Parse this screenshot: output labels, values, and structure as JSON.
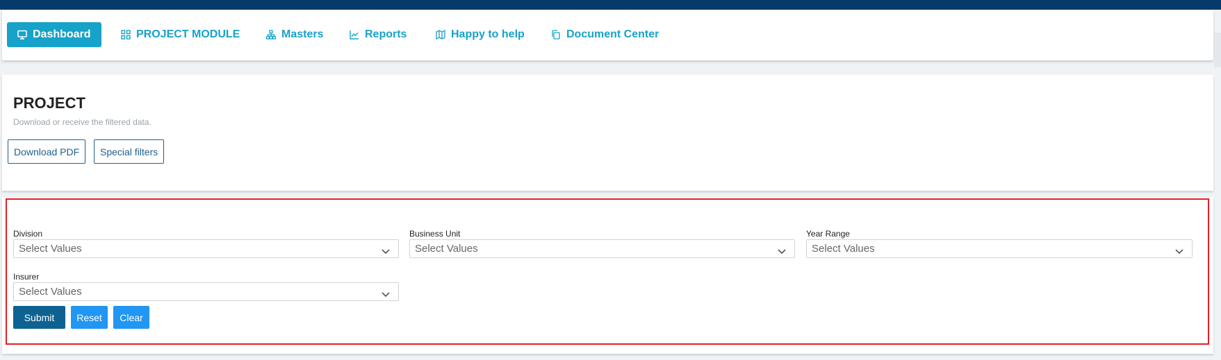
{
  "nav": {
    "items": [
      {
        "label": "Dashboard",
        "icon": "monitor-icon",
        "active": true
      },
      {
        "label": "PROJECT MODULE",
        "icon": "grid-icon"
      },
      {
        "label": "Masters",
        "icon": "sitemap-icon"
      },
      {
        "label": "Reports",
        "icon": "chart-line-icon"
      },
      {
        "label": "Happy to help",
        "icon": "map-icon"
      },
      {
        "label": "Document Center",
        "icon": "copy-icon"
      }
    ]
  },
  "project": {
    "title": "PROJECT",
    "subtitle": "Download or receive the filtered data.",
    "download_pdf_label": "Download PDF",
    "special_filters_label": "Special filters"
  },
  "filters": {
    "division": {
      "label": "Division",
      "placeholder": "Select Values"
    },
    "business_unit": {
      "label": "Business Unit",
      "placeholder": "Select Values"
    },
    "year_range": {
      "label": "Year Range",
      "placeholder": "Select Values"
    },
    "insurer": {
      "label": "Insurer",
      "placeholder": "Select Values"
    }
  },
  "actions": {
    "submit_label": "Submit",
    "reset_label": "Reset",
    "clear_label": "Clear"
  },
  "colors": {
    "header_bar": "#063a6b",
    "accent": "#17a2c9",
    "submit": "#0d6291",
    "reset_clear": "#2196f3",
    "highlight_frame": "#e31e24"
  }
}
